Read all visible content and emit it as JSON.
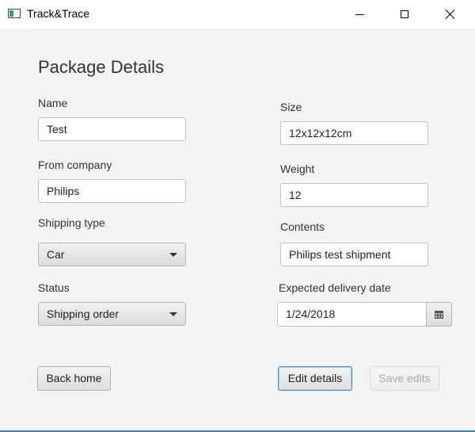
{
  "window": {
    "title": "Track&Trace"
  },
  "page": {
    "heading": "Package Details"
  },
  "form": {
    "name": {
      "label": "Name",
      "value": "Test"
    },
    "from_company": {
      "label": "From company",
      "value": "Philips"
    },
    "shipping_type": {
      "label": "Shipping type",
      "selected": "Car"
    },
    "status": {
      "label": "Status",
      "selected": "Shipping order"
    },
    "size": {
      "label": "Size",
      "value": "12x12x12cm"
    },
    "weight": {
      "label": "Weight",
      "value": "12"
    },
    "contents": {
      "label": "Contents",
      "value": "Philips test shipment"
    },
    "expected_delivery": {
      "label": "Expected delivery date",
      "value": "1/24/2018"
    }
  },
  "buttons": {
    "back_home": "Back home",
    "edit_details": "Edit details",
    "save_edits": "Save edits"
  },
  "icons": {
    "app": "app-window-icon",
    "minimize": "minimize-icon",
    "maximize": "maximize-icon",
    "close": "close-icon",
    "dropdown": "chevron-down-icon",
    "calendar": "calendar-icon"
  },
  "colors": {
    "accent": "#3c7fc1",
    "focus_border": "#3a8fd8",
    "background": "#f4f4f4"
  }
}
